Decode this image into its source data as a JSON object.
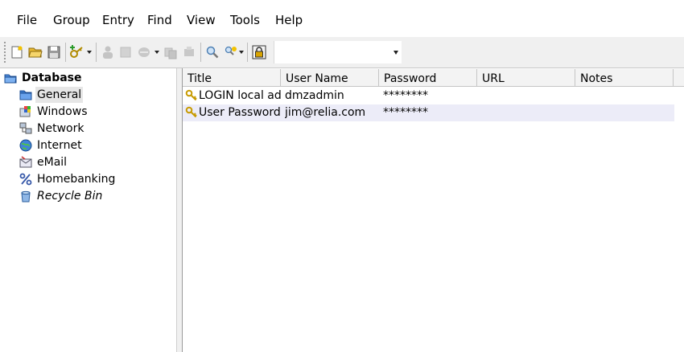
{
  "menu": [
    "File",
    "Group",
    "Entry",
    "Find",
    "View",
    "Tools",
    "Help"
  ],
  "toolbar": {
    "buttons": [
      "new-database-icon",
      "open-database-icon",
      "save-database-icon",
      "add-entry-icon",
      "edit-entry-icon",
      "delete-entry-icon",
      "copy-username-icon",
      "copy-password-icon",
      "open-url-icon",
      "find-icon",
      "find-options-icon",
      "lock-workspace-icon"
    ],
    "quick_find_value": ""
  },
  "tree": {
    "root": "Database",
    "groups": [
      {
        "label": "General",
        "icon": "folder-icon",
        "selected": true
      },
      {
        "label": "Windows",
        "icon": "windows-icon"
      },
      {
        "label": "Network",
        "icon": "network-icon"
      },
      {
        "label": "Internet",
        "icon": "globe-icon"
      },
      {
        "label": "eMail",
        "icon": "email-icon"
      },
      {
        "label": "Homebanking",
        "icon": "percent-icon"
      },
      {
        "label": "Recycle Bin",
        "icon": "recycle-bin-icon",
        "italic": true
      }
    ]
  },
  "list": {
    "columns": [
      "Title",
      "User Name",
      "Password",
      "URL",
      "Notes"
    ],
    "rows": [
      {
        "title": "LOGIN local adr",
        "username": "dmzadmin",
        "password": "********",
        "url": "",
        "notes": ""
      },
      {
        "title": "User Password",
        "username": "jim@relia.com",
        "password": "********",
        "url": "",
        "notes": ""
      }
    ]
  },
  "colors": {
    "selection": "#e6e6e6",
    "alt_row": "#ececf8",
    "folder_blue": "#3a78c9"
  }
}
